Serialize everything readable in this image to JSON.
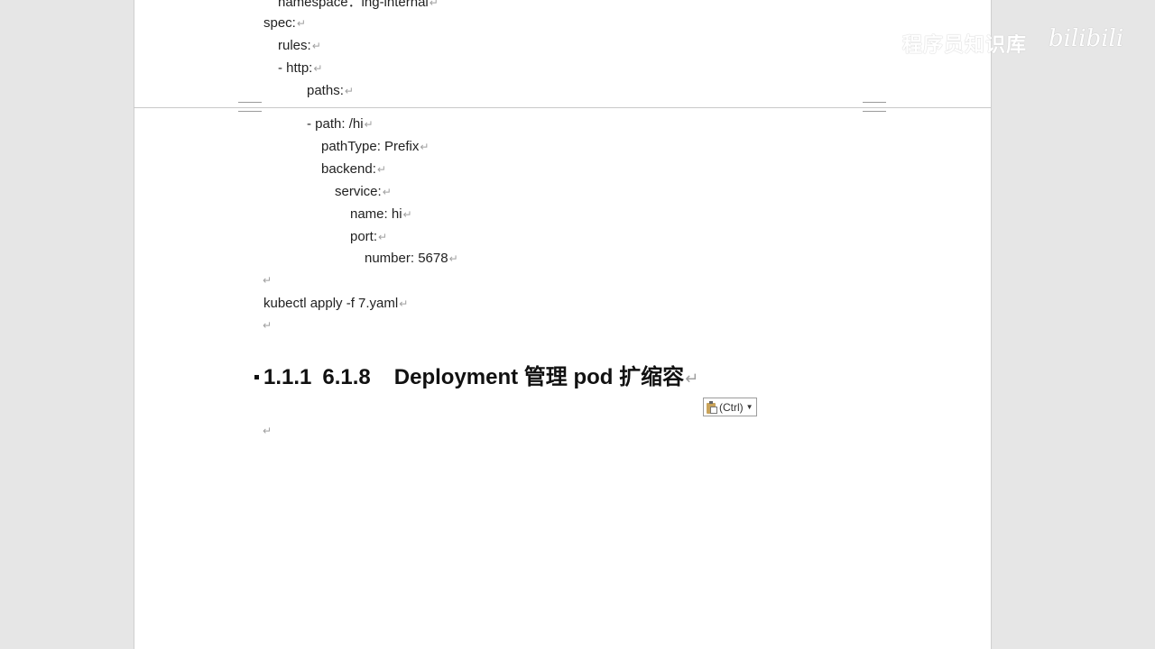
{
  "document": {
    "lines": [
      {
        "id": "namespace",
        "text": "namespace：ing-internal"
      },
      {
        "id": "spec",
        "text": "spec:"
      },
      {
        "id": "rules",
        "text": "rules:"
      },
      {
        "id": "http",
        "text": "- http:"
      },
      {
        "id": "paths",
        "text": "paths:"
      },
      {
        "id": "path",
        "text": "- path: /hi"
      },
      {
        "id": "pathtype",
        "text": "pathType: Prefix"
      },
      {
        "id": "backend",
        "text": "backend:"
      },
      {
        "id": "service",
        "text": "service:"
      },
      {
        "id": "name",
        "text": "name: hi"
      },
      {
        "id": "port",
        "text": "port:"
      },
      {
        "id": "number",
        "text": "number: 5678"
      },
      {
        "id": "blank1",
        "text": ""
      },
      {
        "id": "kubectl",
        "text": "kubectl apply -f 7.yaml"
      },
      {
        "id": "blank2",
        "text": ""
      }
    ],
    "paragraph_mark": "↵",
    "heading": {
      "number": "1.1.1",
      "subnumber": "6.1.8",
      "title": "Deployment 管理 pod 扩缩容"
    },
    "trailing_blank": ""
  },
  "paste_options": {
    "label": "(Ctrl)",
    "icon": "clipboard-paste-icon"
  },
  "watermark": {
    "text": "程序员知识库",
    "logo": "bilibili"
  }
}
